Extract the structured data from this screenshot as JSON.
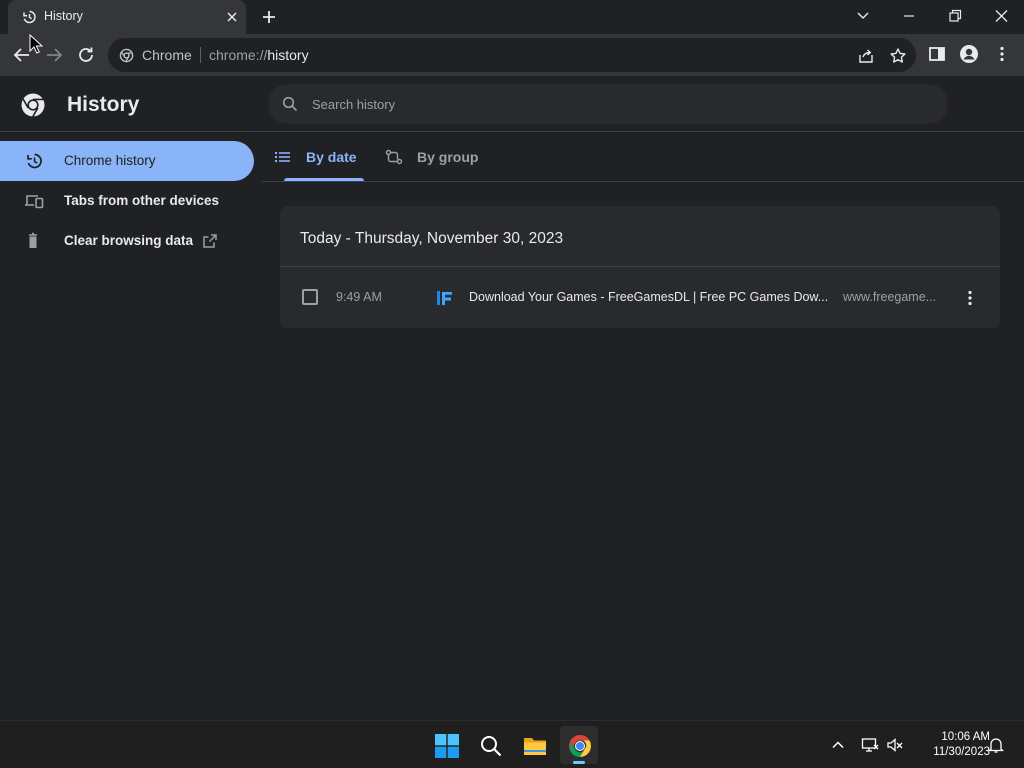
{
  "tab": {
    "title": "History",
    "close_label": "Close"
  },
  "toolbar": {
    "omnibox_site": "Chrome",
    "omnibox_scheme": "chrome://",
    "omnibox_path": "history"
  },
  "header": {
    "title": "History",
    "search_placeholder": "Search history"
  },
  "sidebar": {
    "items": [
      {
        "label": "Chrome history",
        "icon": "history-icon",
        "active": true
      },
      {
        "label": "Tabs from other devices",
        "icon": "devices-icon",
        "active": false
      },
      {
        "label": "Clear browsing data",
        "icon": "trash-icon",
        "active": false
      }
    ]
  },
  "view_tabs": [
    {
      "label": "By date",
      "active": true
    },
    {
      "label": "By group",
      "active": false
    }
  ],
  "history": {
    "date_heading": "Today - Thursday, November 30, 2023",
    "entries": [
      {
        "time": "9:49 AM",
        "title": "Download Your Games - FreeGamesDL | Free PC Games Dow...",
        "domain": "www.freegame...",
        "favicon": "freegamesdl-favicon",
        "checked": false
      }
    ]
  },
  "taskbar": {
    "time": "10:06 AM",
    "date": "11/30/2023",
    "apps": [
      "windows-start",
      "search",
      "file-explorer",
      "chrome"
    ]
  },
  "colors": {
    "background": "#202124",
    "surface": "#292a2d",
    "toolbar": "#35363a",
    "accent": "#8ab4f8",
    "text": "#e8eaed",
    "muted": "#9aa0a6"
  }
}
